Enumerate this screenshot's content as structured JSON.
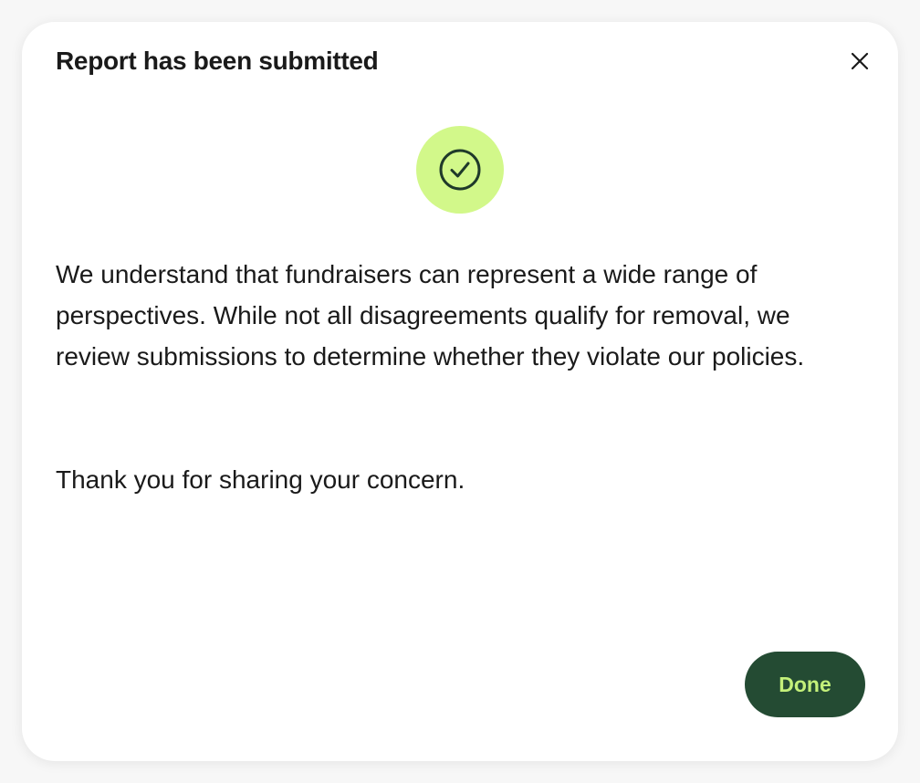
{
  "dialog": {
    "title": "Report has been submitted",
    "close_icon": "close-icon",
    "status_icon": "check-circle-icon",
    "message": "We understand that fundraisers can represent a wide range of perspectives. While not all disagreements qualify for removal, we review submissions to determine whether they violate our policies.",
    "thanks": "Thank you for sharing your concern.",
    "done_label": "Done"
  },
  "colors": {
    "badge_background": "#d2f88a",
    "button_background": "#244b33",
    "button_text": "#c4f07a",
    "text": "#1a1a1a"
  }
}
